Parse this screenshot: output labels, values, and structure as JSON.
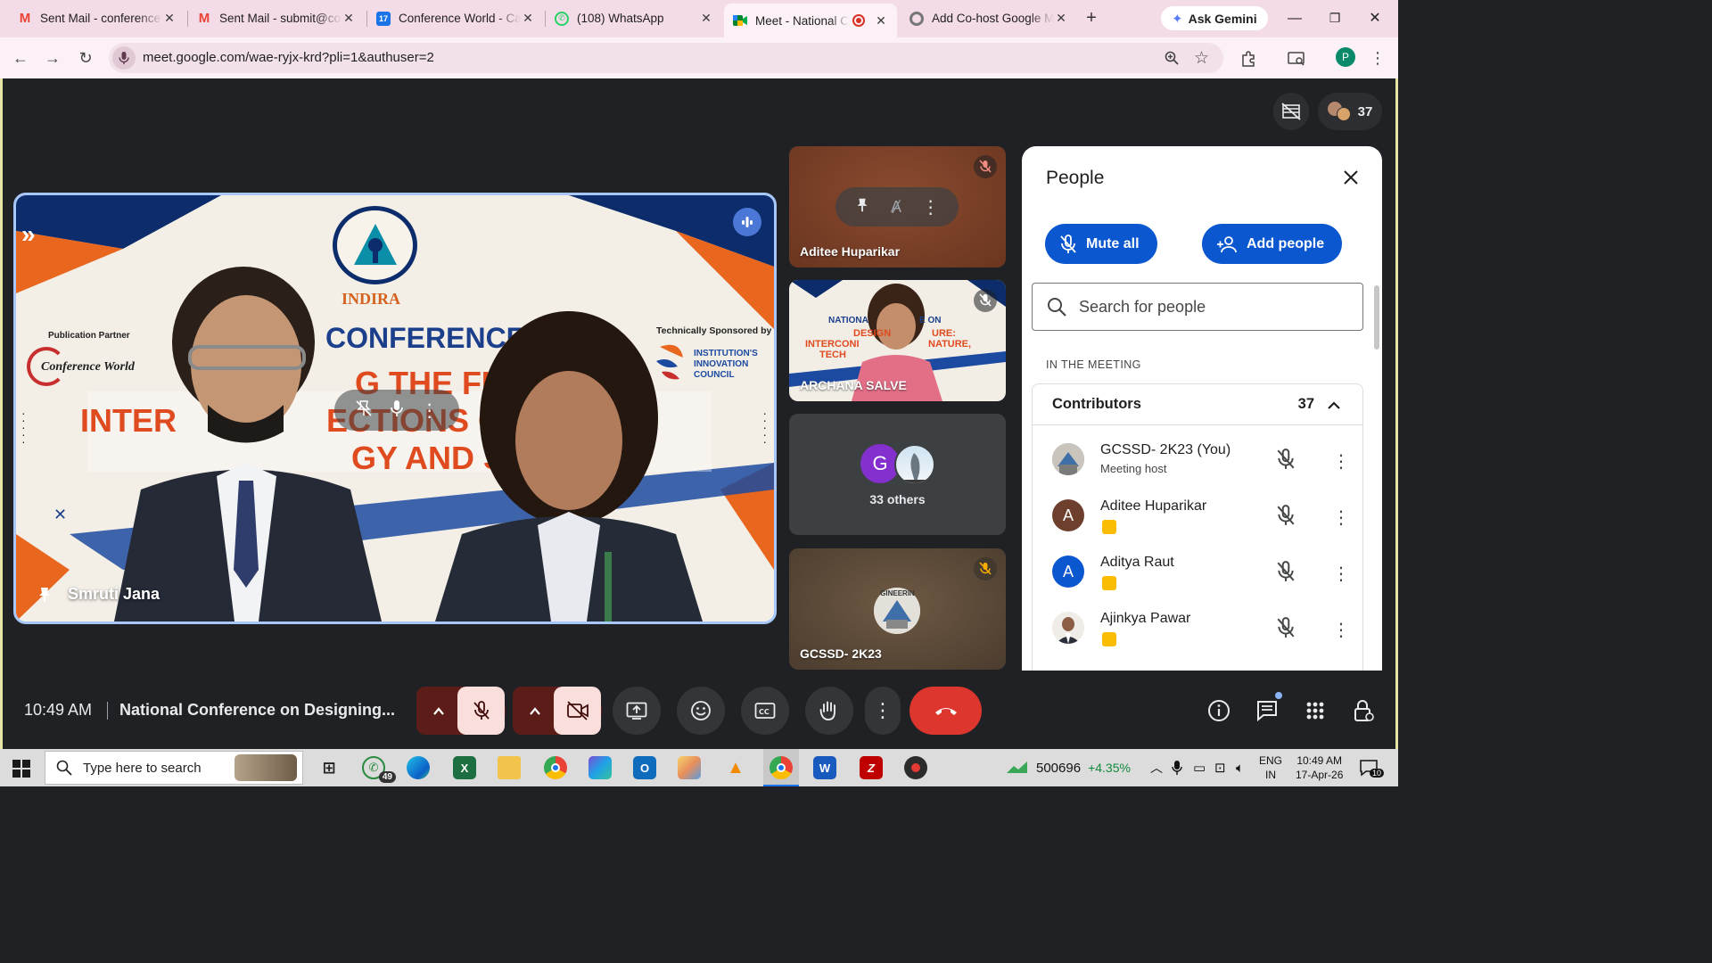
{
  "browser": {
    "tabs": [
      {
        "title": "Sent Mail - conferencew",
        "icon": "gmail-icon"
      },
      {
        "title": "Sent Mail - submit@con",
        "icon": "gmail-icon"
      },
      {
        "title": "Conference World - Cal",
        "icon": "calendar-icon"
      },
      {
        "title": "(108) WhatsApp",
        "icon": "whatsapp-icon"
      },
      {
        "title": "Meet - National Co",
        "icon": "meet-icon",
        "active": true
      },
      {
        "title": "Add Co-host Google M",
        "icon": "chrome-icon"
      }
    ],
    "gemini_label": "Ask Gemini",
    "url": "meet.google.com/wae-ryjx-krd?pli=1&authuser=2",
    "profile_initial": "P"
  },
  "meet": {
    "participant_count": "37",
    "main_tile": {
      "name": "Smruti Jana",
      "banner": {
        "logo_text": "INDIRA",
        "pub_partner_label": "Publication Partner",
        "pub_partner_name": "Conference World",
        "sponsor_label": "Technically Sponsored by",
        "sponsor_name_1": "INSTITUTION'S",
        "sponsor_name_2": "INNOVATION",
        "sponsor_name_3": "COUNCIL",
        "conference": "CONFERENCE",
        "line1": "G THE FUT",
        "line2a": "INTER",
        "line2b": "ECTIONS O",
        "line3": "GY AND S"
      }
    },
    "side_tiles": [
      {
        "name": "Aditee Huparikar"
      },
      {
        "name": "ARCHANA SALVE",
        "banner_1": "NATIONA",
        "banner_2": "DESIGN",
        "banner_3": "INTERCONI",
        "banner_4": "TECH",
        "banner_5": "E ON",
        "banner_6": "URE:",
        "banner_7": "NATURE,"
      },
      {
        "name": "33 others",
        "avatar_initial": "G"
      },
      {
        "name": "GCSSD- 2K23",
        "logo_text": "GINEERIN"
      }
    ],
    "people_panel": {
      "title": "People",
      "mute_all": "Mute all",
      "add_people": "Add people",
      "search_placeholder": "Search for people",
      "section_label": "IN THE MEETING",
      "group_name": "Contributors",
      "group_count": "37",
      "participants": [
        {
          "name": "GCSSD- 2K23 (You)",
          "subtitle": "Meeting host",
          "avatar": "image",
          "avatar_color": "#7a8fa8"
        },
        {
          "name": "Aditee Huparikar",
          "avatar": "A",
          "avatar_color": "#6d3f2c"
        },
        {
          "name": "Aditya Raut",
          "avatar": "A",
          "avatar_color": "#0b57d0"
        },
        {
          "name": "Ajinkya Pawar",
          "avatar": "image",
          "avatar_color": "#e8e4de"
        }
      ]
    },
    "bottom_bar": {
      "time": "10:49 AM",
      "meeting_title": "National Conference on Designing..."
    }
  },
  "taskbar": {
    "search_placeholder": "Type here to search",
    "whatsapp_badge": "49",
    "stock_value": "500696",
    "stock_change": "+4.35%",
    "lang_1": "ENG",
    "lang_2": "IN",
    "time": "10:49 AM",
    "date": "17-Apr-26",
    "notif_count": "10"
  },
  "colors": {
    "meet_red": "#ea4335",
    "meet_blue": "#0b57d0",
    "mute_red_bg": "#f9dedc",
    "tile_active_border": "#a8c7fa"
  }
}
